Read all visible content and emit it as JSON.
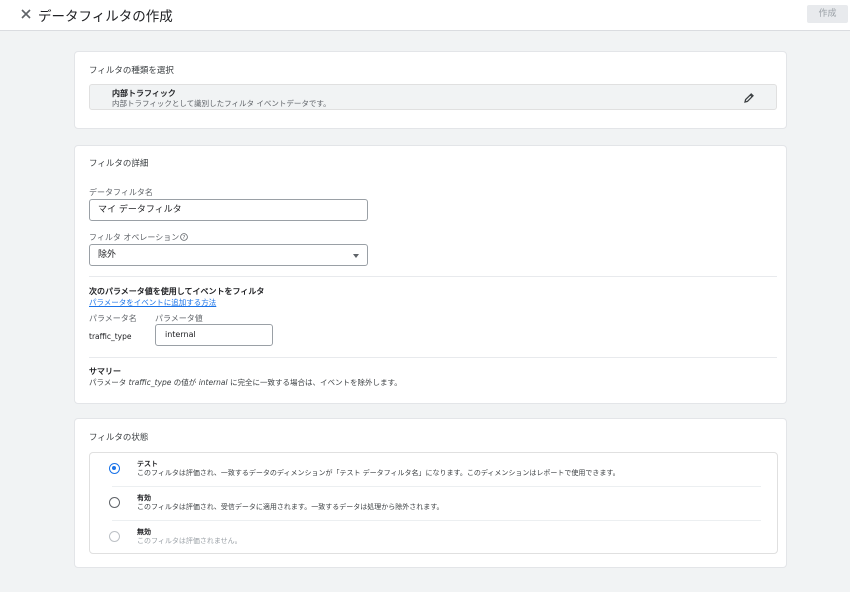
{
  "header": {
    "title": "データフィルタの作成",
    "create_label": "作成"
  },
  "type_card": {
    "title": "フィルタの種類を選択",
    "type_name": "内部トラフィック",
    "type_desc": "内部トラフィックとして識別したフィルタ イベントデータです。"
  },
  "details_card": {
    "title": "フィルタの詳細",
    "name_label": "データフィルタ名",
    "name_value": "マイ データフィルタ",
    "operation_label": "フィルタ オペレーション",
    "operation_value": "除外",
    "param_heading": "次のパラメータ値を使用してイベントをフィルタ",
    "param_link": "パラメータをイベントに追加する方法",
    "col_param_name": "パラメータ名",
    "col_param_value": "パラメータ値",
    "param_name": "traffic_type",
    "param_value": "internal",
    "summary_title": "サマリー",
    "summary_prefix": "パラメータ ",
    "summary_param": "traffic_type",
    "summary_mid": " の値が ",
    "summary_value": "internal",
    "summary_suffix": " に完全に一致する場合は、イベントを除外します。"
  },
  "state_card": {
    "title": "フィルタの状態",
    "options": [
      {
        "name": "テスト",
        "desc": "このフィルタは評価され、一致するデータのディメンションが「テスト データフィルタ名」になります。このディメンションはレポートで使用できます。",
        "checked": true
      },
      {
        "name": "有効",
        "desc": "このフィルタは評価され、受信データに適用されます。一致するデータは処理から除外されます。",
        "checked": false
      },
      {
        "name": "無効",
        "desc": "このフィルタは評価されません。",
        "checked": false
      }
    ]
  },
  "colors": {
    "accent": "#1a73e8",
    "background": "#f1f3f4"
  }
}
